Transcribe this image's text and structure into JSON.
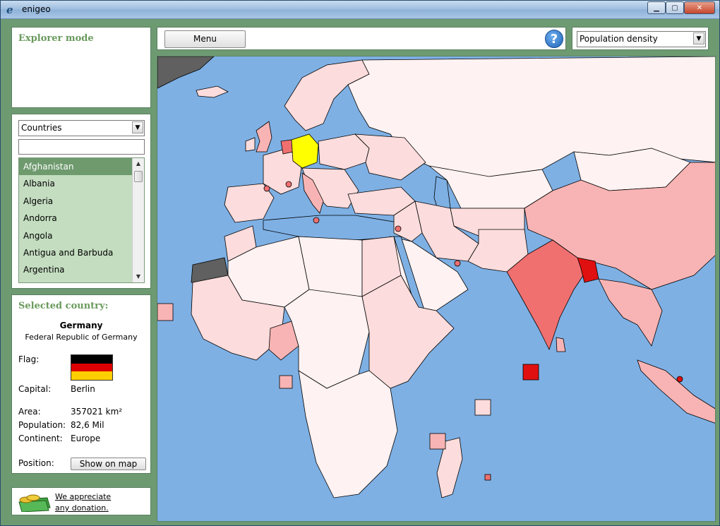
{
  "window": {
    "title": "enigeo",
    "app_icon": "e"
  },
  "sidebar": {
    "explorer_title": "Explorer mode",
    "list_type": "Countries",
    "search_value": "",
    "countries": [
      "Afghanistan",
      "Albania",
      "Algeria",
      "Andorra",
      "Angola",
      "Antigua and Barbuda",
      "Argentina"
    ],
    "selected_index": 0
  },
  "selected_country": {
    "section_title": "Selected country:",
    "name": "Germany",
    "official_name": "Federal Republic of Germany",
    "flag_label": "Flag:",
    "flag_colors": [
      "#000000",
      "#dd0000",
      "#ffce00"
    ],
    "capital_label": "Capital:",
    "capital": "Berlin",
    "area_label": "Area:",
    "area": "357021 km²",
    "population_label": "Population:",
    "population": "82,6 Mil",
    "continent_label": "Continent:",
    "continent": "Europe",
    "position_label": "Position:",
    "show_button": "Show on map"
  },
  "donation": {
    "line1": "We appreciate",
    "line2": "any donation."
  },
  "toolbar": {
    "menu_label": "Menu",
    "help_symbol": "?",
    "mode": "Population density"
  },
  "map": {
    "highlight_color": "#ffff00",
    "ocean_color": "#7eb0e4",
    "no_data_color": "#606060",
    "density_colors": {
      "very_low": "#fff2f2",
      "low": "#fcdcdc",
      "medium": "#f8b4b4",
      "high": "#f07070",
      "very_high": "#e01010"
    }
  }
}
